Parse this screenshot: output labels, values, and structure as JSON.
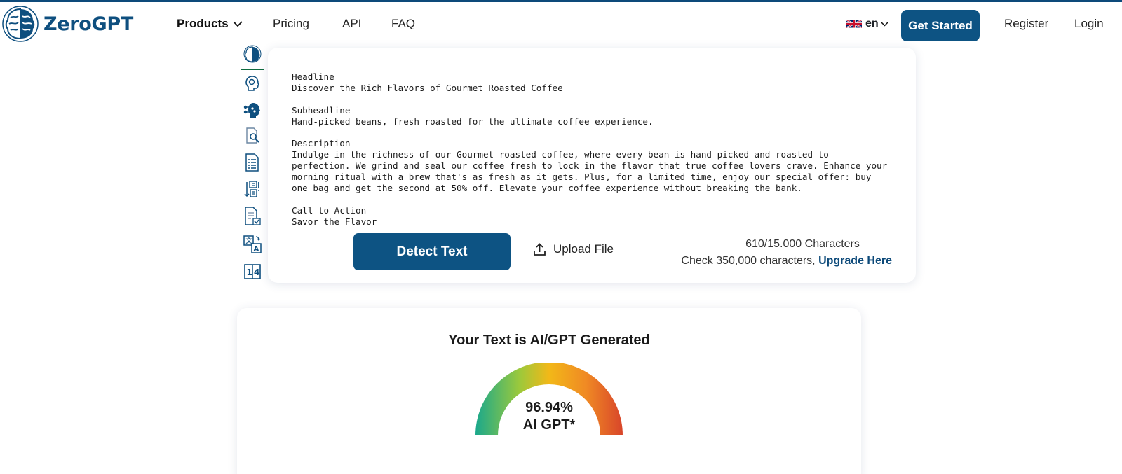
{
  "header": {
    "logo_text": "ZeroGPT",
    "nav": {
      "products": "Products",
      "pricing": "Pricing",
      "api": "API",
      "faq": "FAQ"
    },
    "language": "en",
    "get_started": "Get Started",
    "register": "Register",
    "login": "Login"
  },
  "toolbar": {
    "icons": [
      "brain-logo-icon",
      "ai-head-icon",
      "ai-network-head-icon",
      "document-search-icon",
      "document-list-icon",
      "sort-numbers-icon",
      "document-check-icon",
      "translate-icon",
      "word-counter-icon"
    ]
  },
  "editor": {
    "text": "Headline\nDiscover the Rich Flavors of Gourmet Roasted Coffee\n\nSubheadline\nHand-picked beans, fresh roasted for the ultimate coffee experience.\n\nDescription\nIndulge in the richness of our Gourmet roasted coffee, where every bean is hand-picked and roasted to\nperfection. We grind and seal our coffee fresh to lock in the flavor that true coffee lovers crave. Enhance your\nmorning ritual with a brew that's as fresh as it gets. Plus, for a limited time, enjoy our special offer: buy\none bag and get the second at 50% off. Elevate your coffee experience without breaking the bank.\n\nCall to Action\nSavor the Flavor",
    "detect_button": "Detect Text",
    "upload_label": "Upload File",
    "char_count": "610/15.000 Characters",
    "check_text": "Check 350,000 characters,",
    "upgrade_link": "Upgrade Here"
  },
  "result": {
    "title": "Your Text is AI/GPT Generated",
    "percentage": "96.94%",
    "label": "AI GPT*",
    "gauge_colors": [
      "#1aa88c",
      "#9cc93b",
      "#f2b818",
      "#f08a24",
      "#d8452a"
    ]
  }
}
